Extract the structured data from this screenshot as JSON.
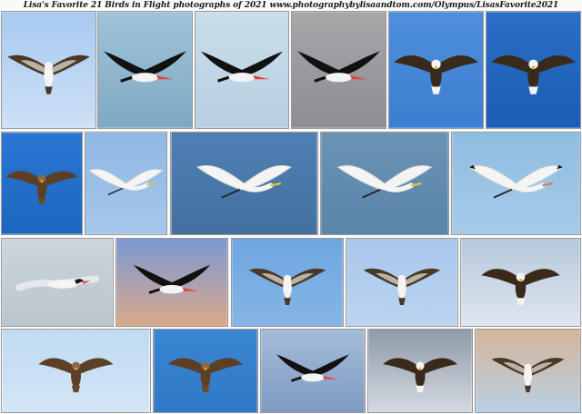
{
  "header": {
    "title": "Lisa's Favorite 21 Birds in Flight photographs of 2021 www.photographybylisaandtom.com/Olympus/LisasFavorite2021"
  },
  "colors": {
    "sky_light": "#a9c9ea",
    "sky_deep": "#1f6fc9",
    "sky_mid": "#6aa0d8",
    "water_gray": "#9fb3c4",
    "sand_pink": "#d9a98b"
  },
  "photos": [
    {
      "name": "photo-osprey-with-fish",
      "bird": "osprey",
      "bg": "#a8caf0",
      "bg2": "#cde0f5"
    },
    {
      "name": "photo-black-skimmer-over-water",
      "bird": "skimmer",
      "bg": "#9fc3d8",
      "bg2": "#7fa9c2"
    },
    {
      "name": "photo-black-skimmer-gliding",
      "bird": "skimmer",
      "bg": "#c9ddea",
      "bg2": "#b7d0e2"
    },
    {
      "name": "photo-black-skimmer-landing",
      "bird": "skimmer",
      "bg": "#a7a7aa",
      "bg2": "#8d8d92"
    },
    {
      "name": "photo-bald-eagle-blue-sky",
      "bird": "eagle",
      "bg": "#4f8fdc",
      "bg2": "#3b7fd0"
    },
    {
      "name": "photo-bald-eagle-deep-blue",
      "bird": "eagle",
      "bg": "#2a6ec6",
      "bg2": "#1c5db5"
    },
    {
      "name": "photo-juvenile-eagle",
      "bird": "hawk",
      "bg": "#2a76d2",
      "bg2": "#1e66c0"
    },
    {
      "name": "photo-egret-wings-up",
      "bird": "egret",
      "bg": "#8fb8e4",
      "bg2": "#a5c7ea"
    },
    {
      "name": "photo-egret-soaring",
      "bird": "egret",
      "bg": "#4f7fb3",
      "bg2": "#43709f"
    },
    {
      "name": "photo-egret-wings-down",
      "bird": "egret",
      "bg": "#6a93b4",
      "bg2": "#5a84a8"
    },
    {
      "name": "photo-white-ibis",
      "bird": "ibis",
      "bg": "#8fbde2",
      "bg2": "#a6cbe8"
    },
    {
      "name": "photo-common-tern",
      "bird": "tern",
      "bg": "#cdd5dc",
      "bg2": "#b9c4cd"
    },
    {
      "name": "photo-skimmer-over-beach",
      "bird": "skimmer",
      "bg": "#7c98d4",
      "bg2": "#d9a98b"
    },
    {
      "name": "photo-osprey-wings-up",
      "bird": "osprey",
      "bg": "#6ea6e0",
      "bg2": "#86b5e6"
    },
    {
      "name": "photo-osprey-banking",
      "bird": "osprey",
      "bg": "#a8c7ec",
      "bg2": "#bcd4f0"
    },
    {
      "name": "photo-bald-eagle-clouds",
      "bird": "eagle",
      "bg": "#b7c8dc",
      "bg2": "#dfe6ee"
    },
    {
      "name": "photo-juvenile-eagle-wings-spread",
      "bird": "hawk",
      "bg": "#bfdaf1",
      "bg2": "#d3e6f6"
    },
    {
      "name": "photo-juvenile-eagle-turning",
      "bird": "hawk",
      "bg": "#3a86d2",
      "bg2": "#2f78c6"
    },
    {
      "name": "photo-skimmer-skimming",
      "bird": "skimmer",
      "bg": "#a6bcd9",
      "bg2": "#7e9ac2"
    },
    {
      "name": "photo-bald-eagle-storm-sky",
      "bird": "eagle",
      "bg": "#8f9aa8",
      "bg2": "#d3d9e0"
    },
    {
      "name": "photo-osprey-sunset-sky",
      "bird": "osprey",
      "bg": "#d6b59a",
      "bg2": "#b7cfe4"
    }
  ]
}
